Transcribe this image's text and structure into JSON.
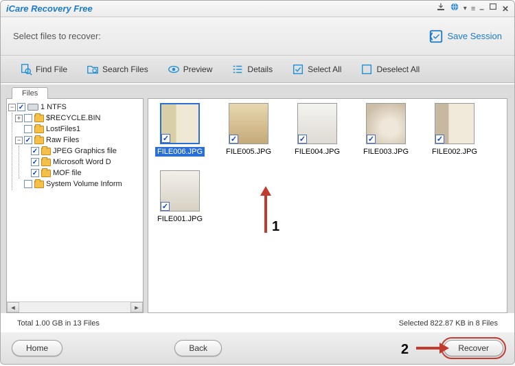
{
  "app": {
    "title": "iCare Recovery Free"
  },
  "header": {
    "prompt": "Select files to recover:",
    "save_session": "Save Session"
  },
  "toolbar": {
    "find": "Find File",
    "search": "Search Files",
    "preview": "Preview",
    "details": "Details",
    "select_all": "Select All",
    "deselect_all": "Deselect All"
  },
  "tree": {
    "tab": "Files",
    "root": "1 NTFS",
    "recycle": "$RECYCLE.BIN",
    "lost": "LostFiles1",
    "raw": "Raw Files",
    "jpeg": "JPEG Graphics file",
    "word": "Microsoft Word D",
    "mof": "MOF file",
    "sysvol": "System Volume Inform"
  },
  "thumbs": {
    "items": [
      {
        "label": "FILE006.JPG"
      },
      {
        "label": "FILE005.JPG"
      },
      {
        "label": "FILE004.JPG"
      },
      {
        "label": "FILE003.JPG"
      },
      {
        "label": "FILE002.JPG"
      },
      {
        "label": "FILE001.JPG"
      }
    ]
  },
  "status": {
    "total": "Total 1.00 GB in 13 Files",
    "selected": "Selected 822.87 KB in 8 Files"
  },
  "footer": {
    "home": "Home",
    "back": "Back",
    "recover": "Recover"
  },
  "anno": {
    "one": "1",
    "two": "2"
  }
}
